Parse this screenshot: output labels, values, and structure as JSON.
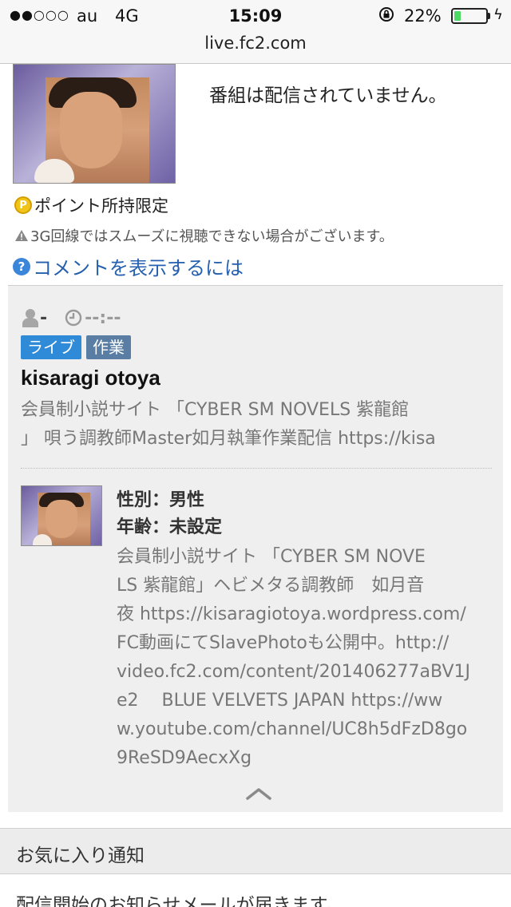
{
  "status_bar": {
    "signal": "●●○○○",
    "carrier": "au",
    "network": "4G",
    "time": "15:09",
    "battery_percent": "22%",
    "battery_level": 0.22
  },
  "url_bar": {
    "domain": "live.fc2.com"
  },
  "stream": {
    "status_message": "番組は配信されていません。",
    "points_notice": "ポイント所持限定",
    "network_warning": "3G回線ではスムーズに視聴できない場合がございます。",
    "comment_link": "コメントを表示するには"
  },
  "info": {
    "viewers": "-",
    "duration": "--:--",
    "tags": [
      "ライブ",
      "作業"
    ],
    "streamer_name": "kisaragi otoya",
    "program_desc_line1": "会員制小説サイト 「CYBER SM NOVELS 紫龍館",
    "program_desc_line2": "」 唄う調教師Master如月執筆作業配信 https://kisa"
  },
  "profile": {
    "gender": "性別：男性",
    "age": "年齢：未設定",
    "description": "会員制小説サイト 「CYBER SM NOVE\nLS 紫龍館」ヘビメタる調教師　如月音\n夜 https://kisaragiotoya.wordpress.com/\nFC動画にてSlavePhotoも公開中。http://\nvideo.fc2.com/content/201406277aBV1J\ne2　 BLUE VELVETS JAPAN https://ww\nw.youtube.com/channel/UC8h5dFzD8go\n9ReSD9AecxXg"
  },
  "favorites": {
    "title": "お気に入り通知",
    "note": "配信開始のお知らせメールが届きます。"
  },
  "colors": {
    "link": "#2560b0",
    "tag_live": "#2f8ad8",
    "tag_work": "#5a7ea3",
    "battery": "#4cd964"
  },
  "icons": {
    "points": "p-coin-icon",
    "warning": "warning-triangle-icon",
    "help": "question-circle-icon",
    "viewer": "person-icon",
    "duration": "clock-icon",
    "collapse": "chevron-up-icon"
  }
}
